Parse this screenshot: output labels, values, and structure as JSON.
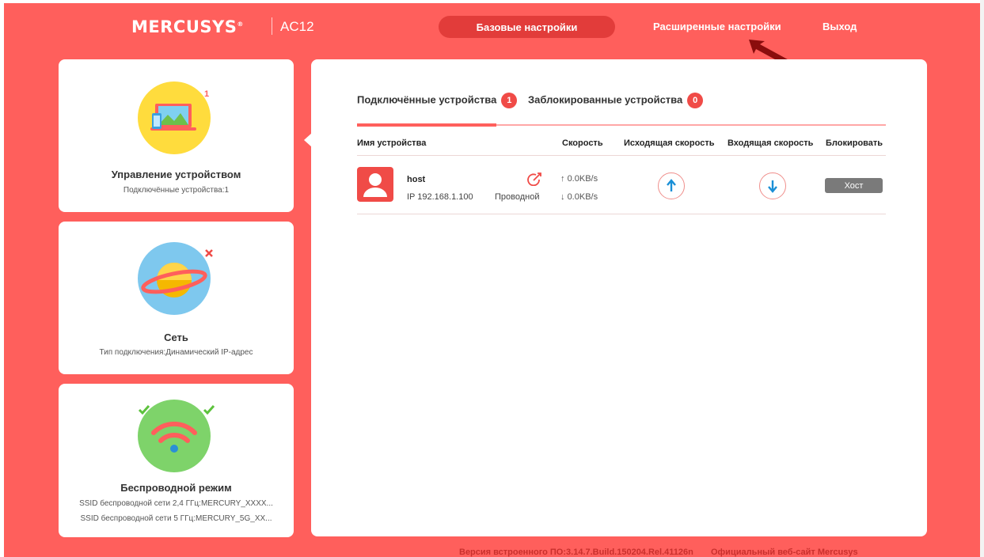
{
  "header": {
    "logo": "MERCUSYS",
    "logo_mark": "®",
    "model": "AC12",
    "nav": {
      "basic": "Базовые настройки",
      "advanced": "Расширенные настройки",
      "exit": "Выход"
    }
  },
  "cards": [
    {
      "title": "Управление устройством",
      "subtitle": "Подключённые устройства:1",
      "badge": "1",
      "icon": "devices-icon"
    },
    {
      "title": "Сеть",
      "subtitle": "Тип подключения:Динамический IP-адрес",
      "badge_icon": "close-icon",
      "icon": "planet-icon"
    },
    {
      "title": "Беспроводной режим",
      "subtitle_1": "SSID беспроводной сети 2,4 ГГц:MERCURY_XXXX...",
      "subtitle_2": "SSID беспроводной сети 5 ГГц:MERCURY_5G_XX...",
      "icon": "wifi-icon"
    }
  ],
  "tabs": [
    {
      "label": "Подключённые устройства",
      "count": "1",
      "active": true
    },
    {
      "label": "Заблокированные устройства",
      "count": "0",
      "active": false
    }
  ],
  "table": {
    "headers": [
      "Имя устройства",
      "Скорость",
      "Исходящая скорость",
      "Входящая скорость",
      "Блокировать"
    ],
    "rows": [
      {
        "name": "host",
        "ip": "IP 192.168.1.100",
        "connection": "Проводной",
        "up_speed": "0.0KB/s",
        "down_speed": "0.0KB/s",
        "block_label": "Хост"
      }
    ]
  },
  "footer": {
    "firmware": "Версия встроенного ПО:3.14.7.Build.150204.Rel.41126n",
    "site": "Официальный веб-сайт Mercusys"
  },
  "colors": {
    "brand": "#ff5f5c",
    "active_nav": "#e23c3a",
    "badge": "#f04b47",
    "block_button": "#7a7a7a"
  }
}
